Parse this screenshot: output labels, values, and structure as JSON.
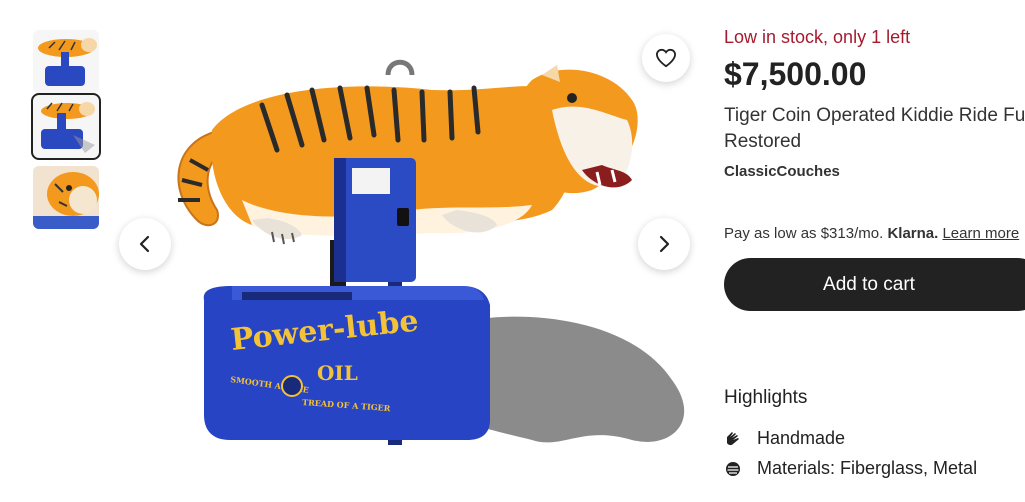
{
  "gallery": {
    "thumbnails": [
      {
        "name": "thumbnail-1",
        "selected": false
      },
      {
        "name": "thumbnail-2",
        "selected": true
      },
      {
        "name": "thumbnail-3",
        "selected": false
      }
    ],
    "prev_icon": "chevron-left-icon",
    "next_icon": "chevron-right-icon",
    "favorite_icon": "heart-icon",
    "main_image_text": {
      "brand": "Power-lube",
      "slogan_left": "SMOOTH AS THE",
      "slogan_right": "TREAD OF A TIGER",
      "oil": "OIL"
    }
  },
  "product": {
    "stock_status": "Low in stock, only 1 left",
    "price": "$7,500.00",
    "title": "Tiger Coin Operated Kiddie Ride Fully Restored",
    "shop_name": "ClassicCouches"
  },
  "financing": {
    "text": "Pay as low as $313/mo.",
    "provider": "Klarna.",
    "link": "Learn more"
  },
  "cart": {
    "button_label": "Add to cart"
  },
  "highlights": {
    "heading": "Highlights",
    "items": [
      {
        "label": "Handmade",
        "icon": "hand-icon"
      },
      {
        "label": "Materials: Fiberglass, Metal",
        "icon": "materials-icon"
      }
    ]
  },
  "colors": {
    "stock_red": "#a61a2e",
    "cart_bg": "#222222",
    "ride_blue": "#1f3fb0",
    "tiger_orange": "#f39a1e"
  }
}
